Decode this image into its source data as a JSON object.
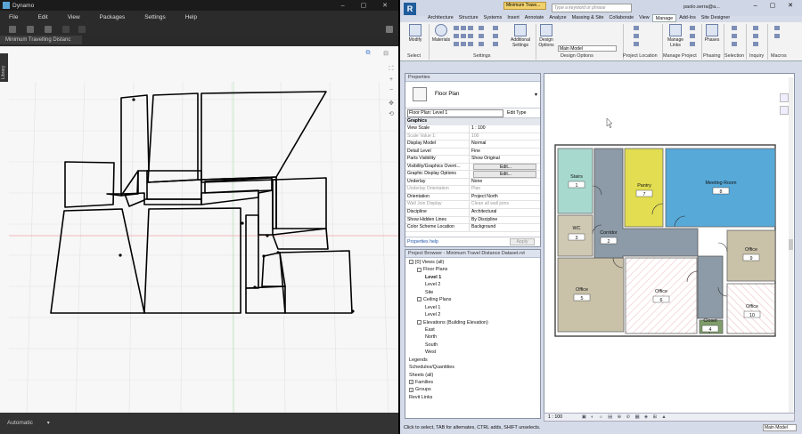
{
  "dynamo": {
    "title": "Dynamo",
    "menu": [
      "File",
      "Edit",
      "View",
      "Packages",
      "Settings",
      "Help"
    ],
    "tab": "Minimum Travelling Distanc",
    "library_label": "Library",
    "run_mode": "Automatic"
  },
  "revit": {
    "title_file": "Minimum Trave...",
    "search_placeholder": "Type a keyword or phrase",
    "user": "paolo.serra@a...",
    "tabs": [
      "Architecture",
      "Structure",
      "Systems",
      "Insert",
      "Annotate",
      "Analyze",
      "Massing & Site",
      "Collaborate",
      "View",
      "Manage",
      "Add-Ins",
      "Site Designer"
    ],
    "active_tab": "Manage",
    "ribbon": {
      "modify": "Modify",
      "materials": "Materials",
      "additional_settings": "Additional Settings",
      "design_options": "Design Options",
      "main_model": "Main Model",
      "manage_links": "Manage Links",
      "phases": "Phases",
      "groups": [
        "Select",
        "Settings",
        "Design Options",
        "Project Location",
        "Manage Project",
        "Phasing",
        "Selection",
        "Inquiry",
        "Macros"
      ]
    },
    "properties": {
      "header": "Properties",
      "type_name": "Floor Plan",
      "filter": "Floor Plan: Level 1",
      "edit_type": "Edit Type",
      "group": "Graphics",
      "rows": [
        {
          "k": "View Scale",
          "v": "1 : 100",
          "g": false
        },
        {
          "k": "Scale Value    1:",
          "v": "100",
          "g": true
        },
        {
          "k": "Display Model",
          "v": "Normal",
          "g": false
        },
        {
          "k": "Detail Level",
          "v": "Fine",
          "g": false
        },
        {
          "k": "Parts Visibility",
          "v": "Show Original",
          "g": false
        },
        {
          "k": "Visibility/Graphics Overri...",
          "v": "Edit...",
          "g": false,
          "btn": true
        },
        {
          "k": "Graphic Display Options",
          "v": "Edit...",
          "g": false,
          "btn": true
        },
        {
          "k": "Underlay",
          "v": "None",
          "g": false
        },
        {
          "k": "Underlay Orientation",
          "v": "Plan",
          "g": true
        },
        {
          "k": "Orientation",
          "v": "Project North",
          "g": false
        },
        {
          "k": "Wall Join Display",
          "v": "Clean all wall joins",
          "g": true
        },
        {
          "k": "Discipline",
          "v": "Architectural",
          "g": false
        },
        {
          "k": "Show Hidden Lines",
          "v": "By Discipline",
          "g": false
        },
        {
          "k": "Color Scheme Location",
          "v": "Background",
          "g": false
        }
      ],
      "help": "Properties help",
      "apply": "Apply"
    },
    "browser": {
      "header": "Project Browser - Minimum Travel Distance Dataset.rvt",
      "nodes": [
        {
          "t": "[0] Views (all)",
          "d": 0,
          "box": "-"
        },
        {
          "t": "Floor Plans",
          "d": 1,
          "box": "-"
        },
        {
          "t": "Level 1",
          "d": 2,
          "bold": true
        },
        {
          "t": "Level 2",
          "d": 2
        },
        {
          "t": "Site",
          "d": 2
        },
        {
          "t": "Ceiling Plans",
          "d": 1,
          "box": "-"
        },
        {
          "t": "Level 1",
          "d": 2
        },
        {
          "t": "Level 2",
          "d": 2
        },
        {
          "t": "Elevations (Building Elevation)",
          "d": 1,
          "box": "-"
        },
        {
          "t": "East",
          "d": 2
        },
        {
          "t": "North",
          "d": 2
        },
        {
          "t": "South",
          "d": 2
        },
        {
          "t": "West",
          "d": 2
        },
        {
          "t": "Legends",
          "d": 0
        },
        {
          "t": "Schedules/Quantities",
          "d": 0
        },
        {
          "t": "Sheets (all)",
          "d": 0
        },
        {
          "t": "Families",
          "d": 0,
          "box": "+"
        },
        {
          "t": "Groups",
          "d": 0,
          "box": "+"
        },
        {
          "t": "Revit Links",
          "d": 0
        }
      ]
    },
    "rooms": [
      {
        "name": "Stairs",
        "num": "1"
      },
      {
        "name": "Pantry",
        "num": "7"
      },
      {
        "name": "Meeting Room",
        "num": "8"
      },
      {
        "name": "WC",
        "num": "3"
      },
      {
        "name": "Corridor",
        "num": "2"
      },
      {
        "name": "Office",
        "num": "9"
      },
      {
        "name": "Office",
        "num": "5"
      },
      {
        "name": "Office",
        "num": "6"
      },
      {
        "name": "Office",
        "num": "10"
      },
      {
        "name": "Closet",
        "num": "4"
      }
    ],
    "view_scale": "1 : 100",
    "status": "Click to select, TAB for alternates, CTRL adds, SHIFT unselects.",
    "status_model": "Main Model",
    "colors": {
      "stairs": "#a8d9cf",
      "pantry": "#e2dd51",
      "meeting": "#57a9d8",
      "corridor": "#8c9ba7",
      "office_tan": "#c9c1a8",
      "hatch": "#e69aa0",
      "closet": "#7f9d6a"
    }
  }
}
